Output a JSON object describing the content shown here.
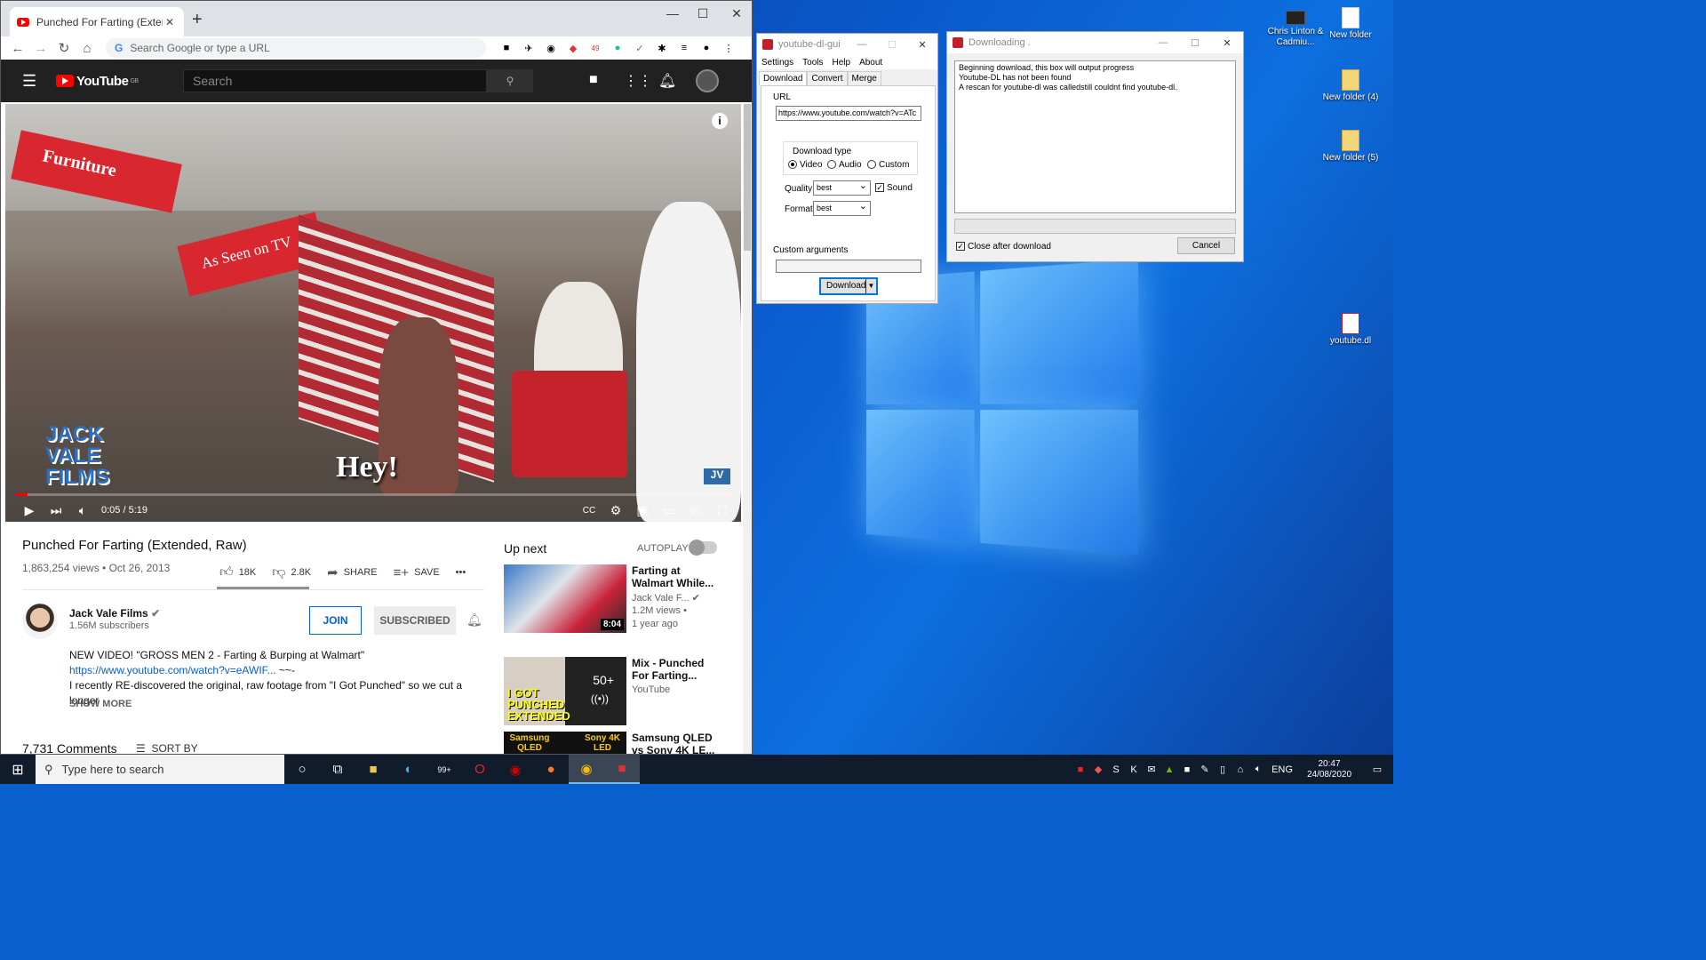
{
  "browser": {
    "tab_title": "Punched For Farting (Extended, R",
    "tab_close": "✕",
    "new_tab": "+",
    "omnibox_placeholder": "Search Google or type a URL",
    "ext_badge": "49",
    "window_controls": [
      "—",
      "☐",
      "✕"
    ]
  },
  "youtube": {
    "logo_text": "YouTube",
    "region": "GB",
    "search_placeholder": "Search",
    "video": {
      "title": "Punched For Farting (Extended, Raw)",
      "views_date": "1,863,254 views • Oct 26, 2013",
      "time": "0:05 / 5:19",
      "progress": 0.016,
      "overlay_text": "Hey!",
      "watermark": "JACK VALE FILMS",
      "badge": "JV",
      "store_sign_1": "Furniture",
      "store_sign_2": "As Seen on TV"
    },
    "actions": {
      "likes": "18K",
      "dislikes": "2.8K",
      "share": "SHARE",
      "save": "SAVE",
      "more": "•••"
    },
    "channel": {
      "name": "Jack Vale Films",
      "subscribers": "1.56M subscribers",
      "join": "JOIN",
      "subscribed": "SUBSCRIBED"
    },
    "description": {
      "line1": "NEW VIDEO! \"GROSS MEN 2 - Farting & Burping at Walmart\"",
      "link": "https://www.youtube.com/watch?v=eAWIF...",
      "link_suffix": " ~~-",
      "line3": "I recently RE-discovered the original, raw footage from \"I Got Punched\" so we cut a longer",
      "show_more": "SHOW MORE"
    },
    "comments": {
      "count": "7,731 Comments",
      "sort": "SORT BY"
    },
    "upnext": {
      "heading": "Up next",
      "autoplay": "AUTOPLAY",
      "items": [
        {
          "title": "Farting at Walmart While...",
          "channel": "Jack Vale F...",
          "views": "1.2M views •",
          "age": "1 year ago",
          "duration": "8:04"
        },
        {
          "title": "Mix - Punched For Farting...",
          "channel": "YouTube",
          "badge": "50+",
          "thumb_text": "I GOT PUNCHED EXTENDED"
        },
        {
          "title": "Samsung QLED vs Sony 4K LE...",
          "thumb_left": "Samsung QLED",
          "thumb_right": "Sony 4K LED"
        }
      ]
    }
  },
  "ytdlgui": {
    "title": "youtube-dl-gui",
    "menu": [
      "Settings",
      "Tools",
      "Help",
      "About"
    ],
    "tabs": [
      "Download",
      "Convert",
      "Merge"
    ],
    "url_label": "URL",
    "url_value": "https://www.youtube.com/watch?v=ATc",
    "download_type_label": "Download type",
    "types": [
      "Video",
      "Audio",
      "Custom"
    ],
    "quality_label": "Quality",
    "quality_value": "best",
    "sound_label": "Sound",
    "format_label": "Format",
    "format_value": "best",
    "custom_args_label": "Custom arguments",
    "download_button": "Download"
  },
  "downloading": {
    "title": "Downloading .",
    "log": [
      "Beginning download, this box will output progress",
      "Youtube-DL has not been found",
      "A rescan for youtube-dl was calledstill couldnt find youtube-dl."
    ],
    "close_after": "Close after download",
    "cancel": "Cancel"
  },
  "desktop_icons": [
    {
      "label": "Chris Linton & Cadmiu..."
    },
    {
      "label": "New folder"
    },
    {
      "label": "New folder (4)"
    },
    {
      "label": "New folder (5)"
    },
    {
      "label": "youtube.dl"
    }
  ],
  "taskbar": {
    "search_placeholder": "Type here to search",
    "mail_badge": "99+",
    "lang": "ENG",
    "time": "20:47",
    "date": "24/08/2020"
  }
}
